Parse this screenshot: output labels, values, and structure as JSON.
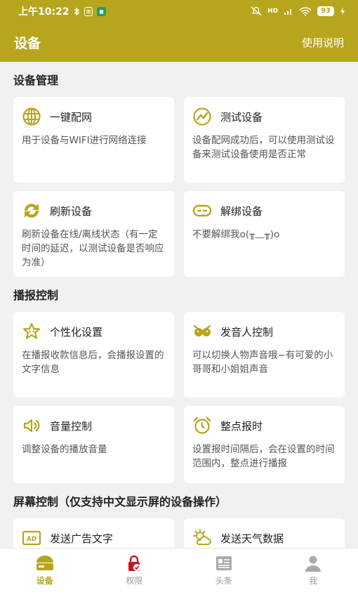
{
  "status_bar": {
    "time": "上午10:22",
    "battery": "93",
    "signal_label": "HD"
  },
  "app_bar": {
    "title": "设备",
    "help_link": "使用说明"
  },
  "sections": [
    {
      "title": "设备管理",
      "cards": [
        {
          "icon": "globe-icon",
          "title": "一键配网",
          "desc": "用于设备与WIFI进行网络连接"
        },
        {
          "icon": "chart-line-icon",
          "title": "测试设备",
          "desc": "设备配网成功后，可以使用测试设备来测试设备使用是否正常"
        },
        {
          "icon": "refresh-icon",
          "title": "刷新设备",
          "desc": "刷新设备在线/离线状态（有一定时间的延迟，以测试设备是否响应为准）"
        },
        {
          "icon": "unlink-icon",
          "title": "解绑设备",
          "desc": "不要解绑我o(╥﹏╥)o"
        }
      ]
    },
    {
      "title": "播报控制",
      "cards": [
        {
          "icon": "sparkle-star-icon",
          "title": "个性化设置",
          "desc": "在播报收款信息后，会播报设置的文字信息"
        },
        {
          "icon": "characters-icon",
          "title": "发音人控制",
          "desc": "可以切换人物声音哦~有可爱的小哥哥和小姐姐声音"
        },
        {
          "icon": "volume-icon",
          "title": "音量控制",
          "desc": "调整设备的播放音量"
        },
        {
          "icon": "alarm-clock-icon",
          "title": "整点报时",
          "desc": "设置报时间隔后，会在设置的时间范围内，整点进行播报"
        }
      ]
    },
    {
      "title": "屏幕控制（仅支持中文显示屏的设备操作）",
      "cards": [
        {
          "icon": "ad-icon",
          "title": "发送广告文字"
        },
        {
          "icon": "weather-icon",
          "title": "发送天气数据"
        }
      ]
    }
  ],
  "tabs": [
    {
      "label": "设备",
      "icon": "device-icon",
      "active": true
    },
    {
      "label": "权限",
      "icon": "lock-icon",
      "active": false
    },
    {
      "label": "头条",
      "icon": "news-icon",
      "active": false
    },
    {
      "label": "我",
      "icon": "person-icon",
      "active": false
    }
  ],
  "colors": {
    "primary": "#b7a51d",
    "background": "#f1f1f3",
    "tab_inactive": "#999999"
  }
}
